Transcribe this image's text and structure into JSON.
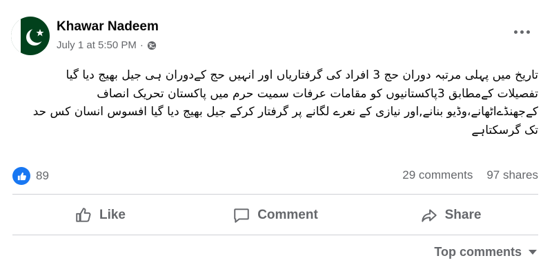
{
  "post": {
    "author": "Khawar Nadeem",
    "timestamp": "July 1 at 5:50 PM",
    "timestamp_separator": "·",
    "privacy_icon": "globe-icon",
    "avatar_icon": "pakistan-flag-avatar",
    "body_lines": [
      "تاریخ میں پہلی مرتبہ دوران حج 3 افراد کی گرفتاریاں اور انہیں حج کےدوران ہی جیل بھیج دیا گیا",
      "تفصیلات کےمطابق 3پاکستانیوں کو مقامات عرفات سمیت حرم میں پاکستان تحریک انصاف کےجھنڈےاٹھانے،وڈیو بنانے,اور نیازی کے نعرے لگانے پر گرفتار کرکے جیل بھیج دیا گیا افسوس انسان کس حد تک گرسکتاہے"
    ]
  },
  "stats": {
    "reaction_count": "89",
    "comments": "29 comments",
    "shares": "97 shares"
  },
  "actions": {
    "like": "Like",
    "comment": "Comment",
    "share": "Share"
  },
  "comments_filter": {
    "label": "Top comments"
  },
  "colors": {
    "accent": "#1877f2",
    "secondary_text": "#65676b",
    "divider": "#ced0d4",
    "flag_green": "#01411c"
  }
}
